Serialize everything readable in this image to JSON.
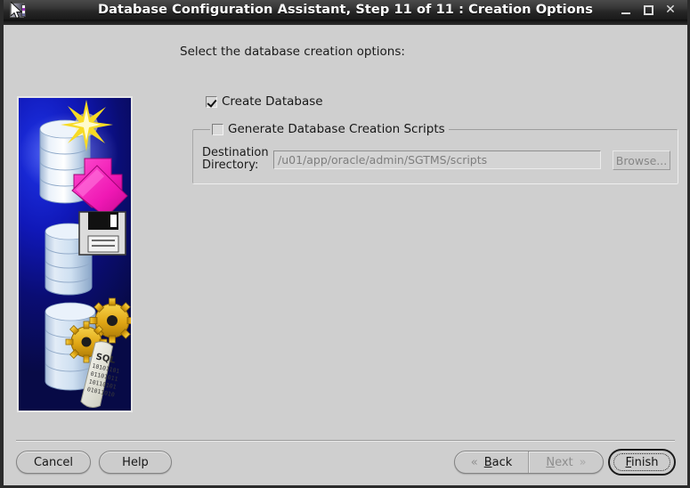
{
  "window": {
    "title": "Database Configuration Assistant, Step 11 of 11 : Creation Options",
    "app_icon": "database-app-icon",
    "controls": {
      "minimize": "minimize-icon",
      "maximize": "maximize-icon",
      "close": "✕"
    }
  },
  "main": {
    "prompt": "Select the database creation options:",
    "create_database": {
      "label": "Create Database",
      "checked": true
    },
    "scripts_group": {
      "label": "Generate Database Creation Scripts",
      "checked": false,
      "destination_label": "Destination\nDirectory:",
      "destination_label_line1": "Destination",
      "destination_label_line2": "Directory:",
      "destination_value": "/u01/app/oracle/admin/SGTMS/scripts",
      "browse_label": "Browse...",
      "enabled": false
    }
  },
  "banner": {
    "name": "database-creation-illustration",
    "description": "Three silver database cylinders on a blue-to-purple gradient: top cylinder with a yellow starburst and a magenta arrow, middle cylinder with a floppy disk, bottom cylinder with yellow gears and a SQL script scroll",
    "colors": {
      "background_blue": "#1018b8",
      "background_purple": "#a018c8",
      "cylinder": "#c6d8ec",
      "star": "#f7d81e",
      "arrow": "#ef23b8",
      "gear": "#e8b21a",
      "scroll": "#e9e9e0"
    },
    "scroll_text": "SQL"
  },
  "footer": {
    "cancel_label": "Cancel",
    "help_label": "Help",
    "back_label": "Back",
    "back_mnemonic": "B",
    "back_chevron": "«",
    "next_label": "Next",
    "next_mnemonic": "N",
    "next_chevron": "»",
    "next_enabled": false,
    "finish_label": "Finish",
    "finish_mnemonic": "F",
    "finish_focused": true
  },
  "theme": {
    "background": "#cfcfcf",
    "titlebar": "#262626",
    "title_text": "#ffffff",
    "disabled_text": "#8d8d8d"
  }
}
